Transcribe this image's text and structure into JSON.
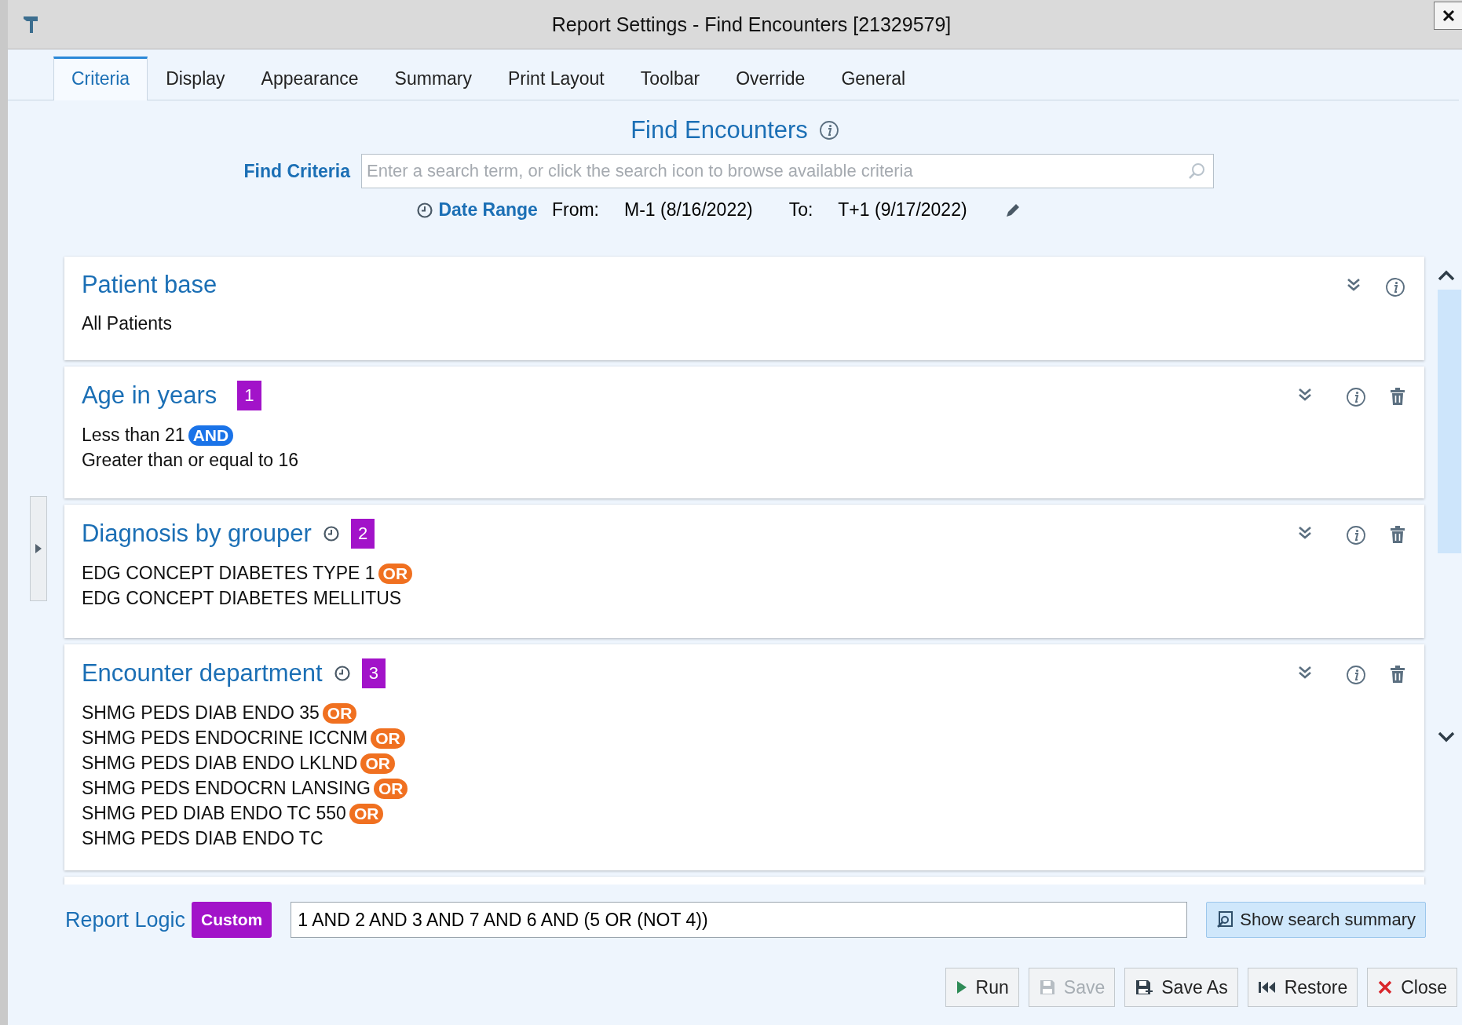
{
  "window": {
    "title": "Report Settings - Find Encounters [21329579]"
  },
  "tabs": [
    {
      "label": "Criteria",
      "selected": true
    },
    {
      "label": "Display",
      "selected": false
    },
    {
      "label": "Appearance",
      "selected": false
    },
    {
      "label": "Summary",
      "selected": false
    },
    {
      "label": "Print Layout",
      "selected": false
    },
    {
      "label": "Toolbar",
      "selected": false
    },
    {
      "label": "Override",
      "selected": false
    },
    {
      "label": "General",
      "selected": false
    }
  ],
  "heading": "Find Encounters",
  "find_criteria": {
    "label": "Find Criteria",
    "placeholder": "Enter a search term, or click the search icon to browse available criteria"
  },
  "date_range": {
    "label": "Date Range",
    "from_label": "From:",
    "from": "M-1 (8/16/2022)",
    "to_label": "To:",
    "to": "T+1 (9/17/2022)"
  },
  "criteria": [
    {
      "title": "Patient base",
      "timed": false,
      "deletable": false,
      "lines": [
        {
          "text": "All Patients"
        }
      ]
    },
    {
      "title": "Age in years",
      "number": "1",
      "timed": false,
      "deletable": true,
      "lines": [
        {
          "text": "Less than 21",
          "connector": {
            "label": "AND",
            "color": "#1a73e8"
          }
        },
        {
          "text": "Greater than or equal to 16"
        }
      ]
    },
    {
      "title": "Diagnosis by grouper",
      "number": "2",
      "timed": true,
      "deletable": true,
      "lines": [
        {
          "text": "EDG CONCEPT DIABETES TYPE 1",
          "connector": {
            "label": "OR",
            "color": "#f07020"
          }
        },
        {
          "text": "EDG CONCEPT DIABETES MELLITUS"
        }
      ]
    },
    {
      "title": "Encounter department",
      "number": "3",
      "timed": true,
      "deletable": true,
      "lines": [
        {
          "text": "SHMG PEDS DIAB ENDO 35",
          "connector": {
            "label": "OR",
            "color": "#f07020"
          }
        },
        {
          "text": "SHMG PEDS ENDOCRINE ICCNM",
          "connector": {
            "label": "OR",
            "color": "#f07020"
          }
        },
        {
          "text": "SHMG PEDS DIAB ENDO LKLND",
          "connector": {
            "label": "OR",
            "color": "#f07020"
          }
        },
        {
          "text": "SHMG PEDS ENDOCRN LANSING",
          "connector": {
            "label": "OR",
            "color": "#f07020"
          }
        },
        {
          "text": "SHMG PED DIAB ENDO TC 550",
          "connector": {
            "label": "OR",
            "color": "#f07020"
          }
        },
        {
          "text": "SHMG PEDS DIAB ENDO TC"
        }
      ]
    }
  ],
  "report_logic": {
    "label": "Report Logic",
    "mode": "Custom",
    "value": "1 AND 2 AND 3 AND 7 AND 6 AND (5 OR (NOT 4))"
  },
  "summary_button": {
    "label": "Show search summary"
  },
  "buttons": [
    {
      "label": "Run",
      "kind": "run",
      "disabled": false
    },
    {
      "label": "Save",
      "kind": "save",
      "disabled": true
    },
    {
      "label": "Save As",
      "kind": "saveas",
      "disabled": false
    },
    {
      "label": "Restore",
      "kind": "restore",
      "disabled": false
    },
    {
      "label": "Close",
      "kind": "close",
      "disabled": false
    }
  ]
}
